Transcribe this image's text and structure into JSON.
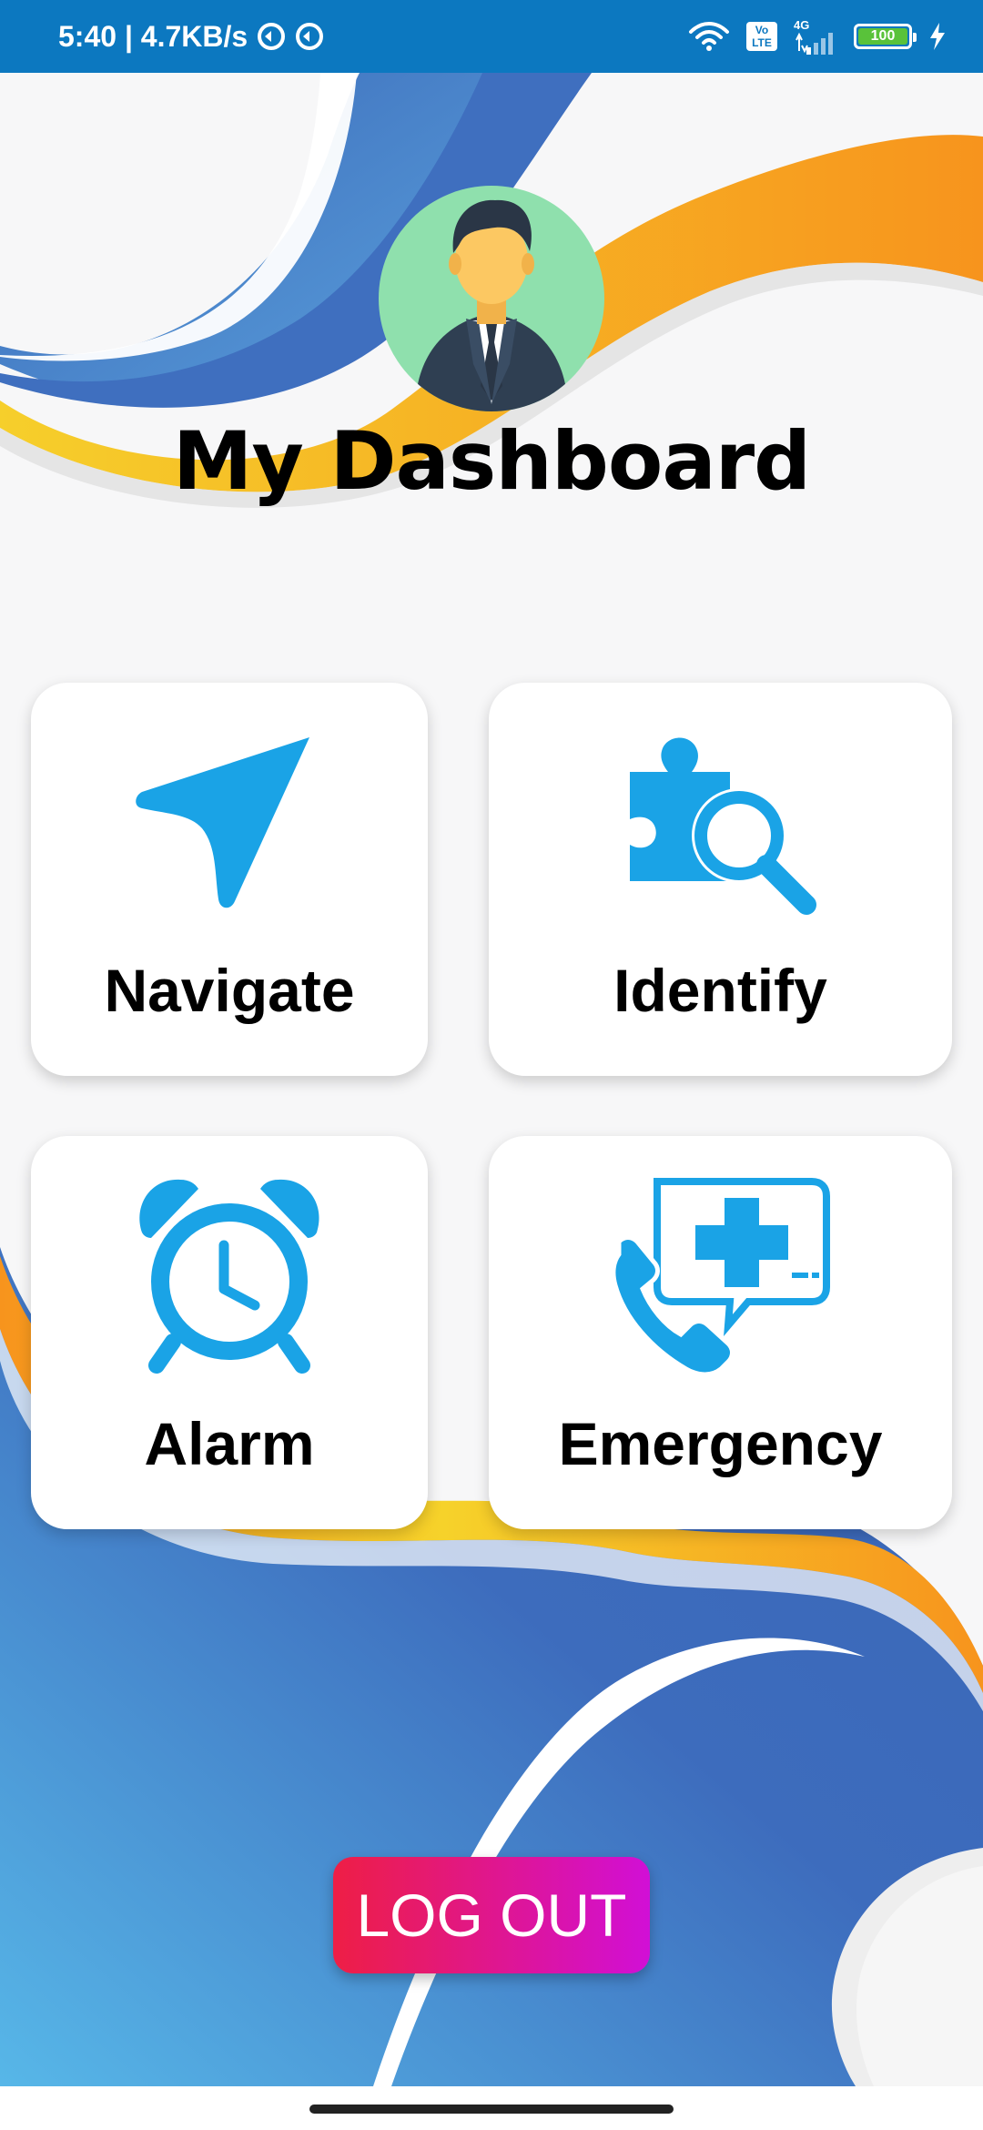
{
  "status_bar": {
    "time_speed": "5:40 | 4.7KB/s",
    "volte_top": "Vo",
    "volte_bottom": "LTE",
    "network": "4G",
    "battery": "100"
  },
  "header": {
    "title": "My Dashboard"
  },
  "cards": [
    {
      "label": "Navigate",
      "icon": "navigation-arrow-icon"
    },
    {
      "label": "Identify",
      "icon": "puzzle-search-icon"
    },
    {
      "label": "Alarm",
      "icon": "alarm-clock-icon"
    },
    {
      "label": "Emergency",
      "icon": "emergency-call-icon"
    }
  ],
  "logout": {
    "label": "LOG OUT"
  },
  "colors": {
    "status_bar": "#0c78c0",
    "icon_blue": "#1aa3e6",
    "accent_orange": "#f7941d",
    "accent_yellow": "#f6d22a",
    "wave_blue": "#3f6fbf",
    "logout_start": "#ee1e45",
    "logout_end": "#d10fd6"
  }
}
